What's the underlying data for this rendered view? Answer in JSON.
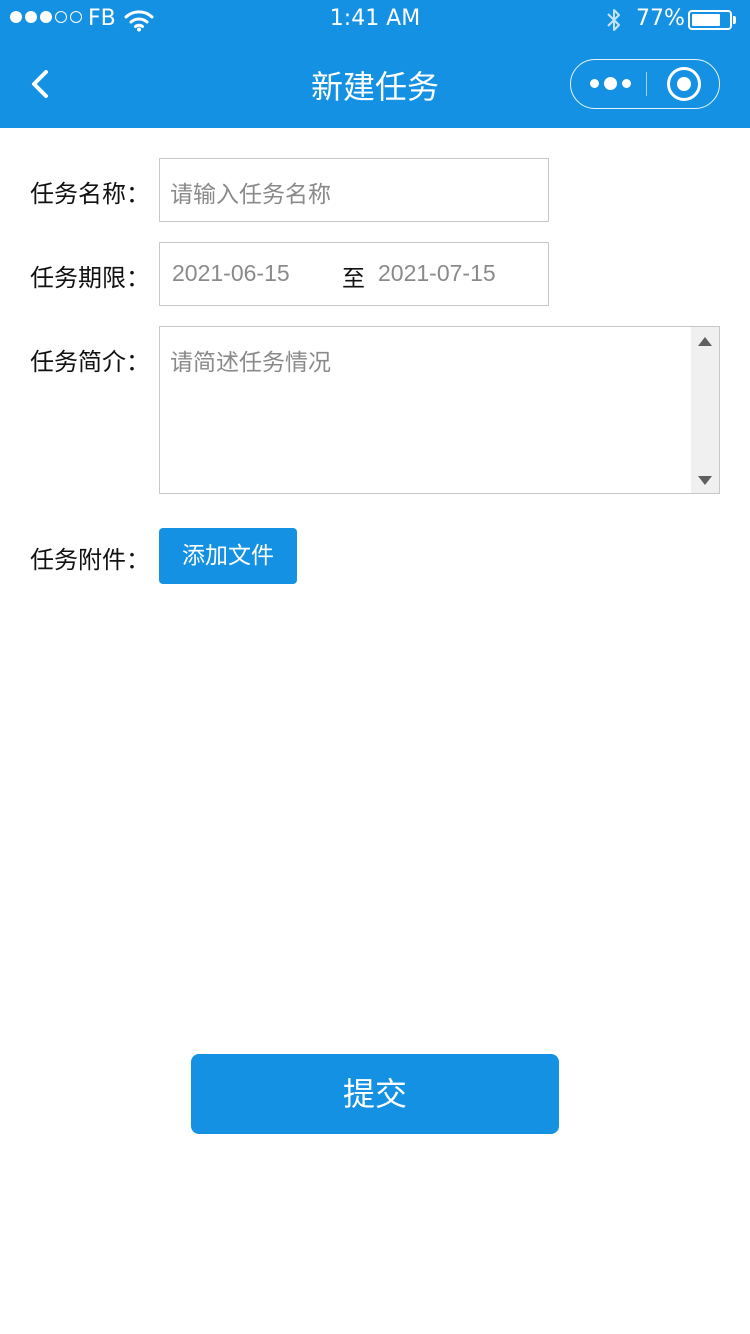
{
  "status_bar": {
    "carrier": "FB",
    "time": "1:41 AM",
    "battery": "77%",
    "battery_level": 0.77,
    "signal_filled": 3,
    "signal_total": 5
  },
  "nav": {
    "title": "新建任务"
  },
  "form": {
    "name": {
      "label": "任务名称：",
      "placeholder": "请输入任务名称"
    },
    "period": {
      "label": "任务期限：",
      "start": "2021-06-15",
      "separator": "至",
      "end": "2021-07-15"
    },
    "intro": {
      "label": "任务简介：",
      "placeholder": "请简述任务情况"
    },
    "attachment": {
      "label": "任务附件：",
      "button": "添加文件"
    }
  },
  "submit": {
    "label": "提交"
  },
  "colors": {
    "primary": "#1491E3",
    "placeholder": "#8a8a8a",
    "border": "#c8c8c8"
  },
  "icons": [
    "back-chevron-icon",
    "wifi-icon",
    "bluetooth-icon",
    "battery-icon",
    "more-dots-icon",
    "close-target-icon"
  ]
}
